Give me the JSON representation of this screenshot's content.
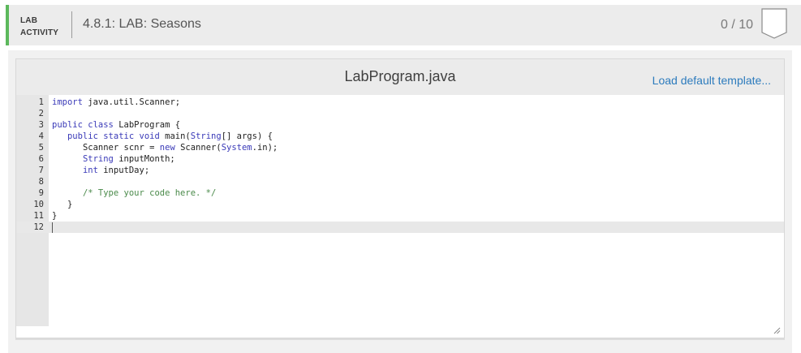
{
  "header": {
    "tag_line1": "LAB",
    "tag_line2": "ACTIVITY",
    "title": "4.8.1: LAB: Seasons",
    "score": "0 / 10",
    "accent_color": "#5cb85c"
  },
  "editor": {
    "filename": "LabProgram.java",
    "load_template_label": "Load default template...",
    "active_line": 12,
    "lines": [
      {
        "num": "1",
        "text": "import java.util.Scanner;"
      },
      {
        "num": "2",
        "text": ""
      },
      {
        "num": "3",
        "text": "public class LabProgram {"
      },
      {
        "num": "4",
        "text": "   public static void main(String[] args) {"
      },
      {
        "num": "5",
        "text": "      Scanner scnr = new Scanner(System.in);"
      },
      {
        "num": "6",
        "text": "      String inputMonth;"
      },
      {
        "num": "7",
        "text": "      int inputDay;"
      },
      {
        "num": "8",
        "text": ""
      },
      {
        "num": "9",
        "text": "      /* Type your code here. */"
      },
      {
        "num": "10",
        "text": "   }"
      },
      {
        "num": "11",
        "text": "}"
      },
      {
        "num": "12",
        "text": ""
      }
    ]
  }
}
